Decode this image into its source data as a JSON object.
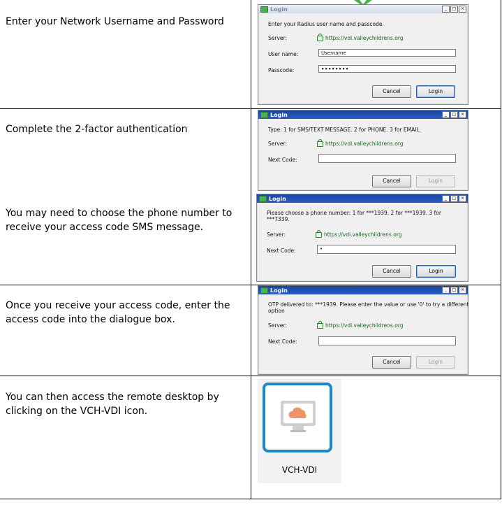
{
  "steps": [
    {
      "instruction": "Enter your Network Username and Password"
    },
    {
      "instruction": "Complete the 2-factor authentication"
    },
    {
      "instruction": "You may need to choose the phone number to receive your access code SMS message."
    },
    {
      "instruction": "Once you receive your access code, enter the access code into the dialogue box."
    },
    {
      "instruction": "You can then access the remote desktop by clicking on the VCH-VDI icon."
    }
  ],
  "dialogs": {
    "login1": {
      "title": "Login",
      "prompt": "Enter your Radius user name and passcode.",
      "server_label": "Server:",
      "server_url": "https://vdi.valleychildrens.org",
      "username_label": "User name:",
      "username_value": "Username",
      "passcode_label": "Passcode:",
      "passcode_value": "••••••••",
      "cancel": "Cancel",
      "login": "Login"
    },
    "login2": {
      "title": "Login",
      "prompt": "Type:   1 for SMS/TEXT MESSAGE.   2 for PHONE.   3 for EMAIL.",
      "server_label": "Server:",
      "server_url": "https://vdi.valleychildrens.org",
      "code_label": "Next Code:",
      "code_value": "",
      "cancel": "Cancel",
      "login": "Login"
    },
    "login3": {
      "title": "Login",
      "prompt_line1": "Please choose a phone number:   1 for ***1939.   2 for ***1939.   3 for",
      "prompt_line2": "***7339.",
      "server_label": "Server:",
      "server_url": "https://vdi.valleychildrens.org",
      "code_label": "Next Code:",
      "code_value": "•",
      "cancel": "Cancel",
      "login": "Login"
    },
    "login4": {
      "title": "Login",
      "prompt_line1": "OTP delivered to: ***1939. Please enter the value or use '0' to try a different",
      "prompt_line2": "option",
      "server_label": "Server:",
      "server_url": "https://vdi.valleychildrens.org",
      "code_label": "Next Code:",
      "code_value": "",
      "cancel": "Cancel",
      "login": "Login"
    }
  },
  "vdi": {
    "label": "VCH-VDI"
  },
  "colors": {
    "tile_border": "#1f86c8",
    "cloud": "#f0926a",
    "url_green": "#1b5e20"
  }
}
